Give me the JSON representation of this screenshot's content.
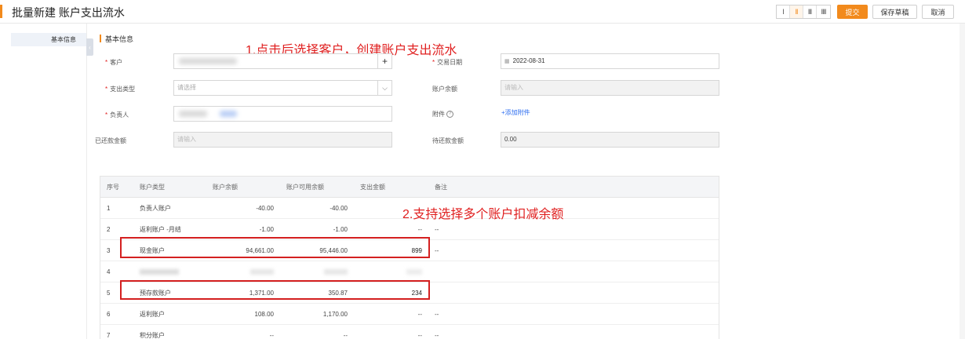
{
  "header": {
    "title": "批量新建 账户支出流水",
    "view_modes": [
      "I",
      "II",
      "III",
      "IIII"
    ],
    "submit_label": "提交",
    "save_draft_label": "保存草稿",
    "cancel_label": "取消",
    "accent_color": "#f28a1c"
  },
  "sidebar": {
    "items": [
      {
        "label": "基本信息"
      }
    ]
  },
  "section": {
    "title": "基本信息"
  },
  "annotations": {
    "step1": "1.点击后选择客户，创建账户支出流水",
    "step2": "2.支持选择多个账户扣减余额",
    "color": "#e02020"
  },
  "form": {
    "customer": {
      "label": "客户",
      "value": ""
    },
    "trade_date": {
      "label": "交易日期",
      "value": "2022-08-31"
    },
    "expense_type": {
      "label": "支出类型",
      "placeholder": "请选择"
    },
    "account_balance": {
      "label": "账户余额",
      "placeholder": "请输入"
    },
    "owner": {
      "label": "负责人"
    },
    "attachment": {
      "label": "附件",
      "add_label": "+添加附件"
    },
    "repaid_amount": {
      "label": "已还款金额",
      "placeholder": "请输入"
    },
    "pending_amount": {
      "label": "待还款金额",
      "value": "0.00"
    }
  },
  "table": {
    "columns": [
      "序号",
      "账户类型",
      "账户余额",
      "账户可用余额",
      "支出金额",
      "备注"
    ],
    "rows": [
      {
        "no": "1",
        "type": "负责人账户",
        "balance": "-40.00",
        "available": "-40.00",
        "expense": "",
        "note": ""
      },
      {
        "no": "2",
        "type": "返利账户 -月结",
        "balance": "-1.00",
        "available": "-1.00",
        "expense": "--",
        "note": "--"
      },
      {
        "no": "3",
        "type": "现金账户",
        "balance": "94,661.00",
        "available": "95,446.00",
        "expense": "899",
        "note": "--"
      },
      {
        "no": "4",
        "type": "",
        "balance": "",
        "available": "",
        "expense": "",
        "note": ""
      },
      {
        "no": "5",
        "type": "预存款账户",
        "balance": "1,371.00",
        "available": "350.87",
        "expense": "234",
        "note": ""
      },
      {
        "no": "6",
        "type": "返利账户",
        "balance": "108.00",
        "available": "1,170.00",
        "expense": "--",
        "note": "--"
      },
      {
        "no": "7",
        "type": "积分账户",
        "balance": "--",
        "available": "--",
        "expense": "--",
        "note": "--"
      }
    ]
  }
}
